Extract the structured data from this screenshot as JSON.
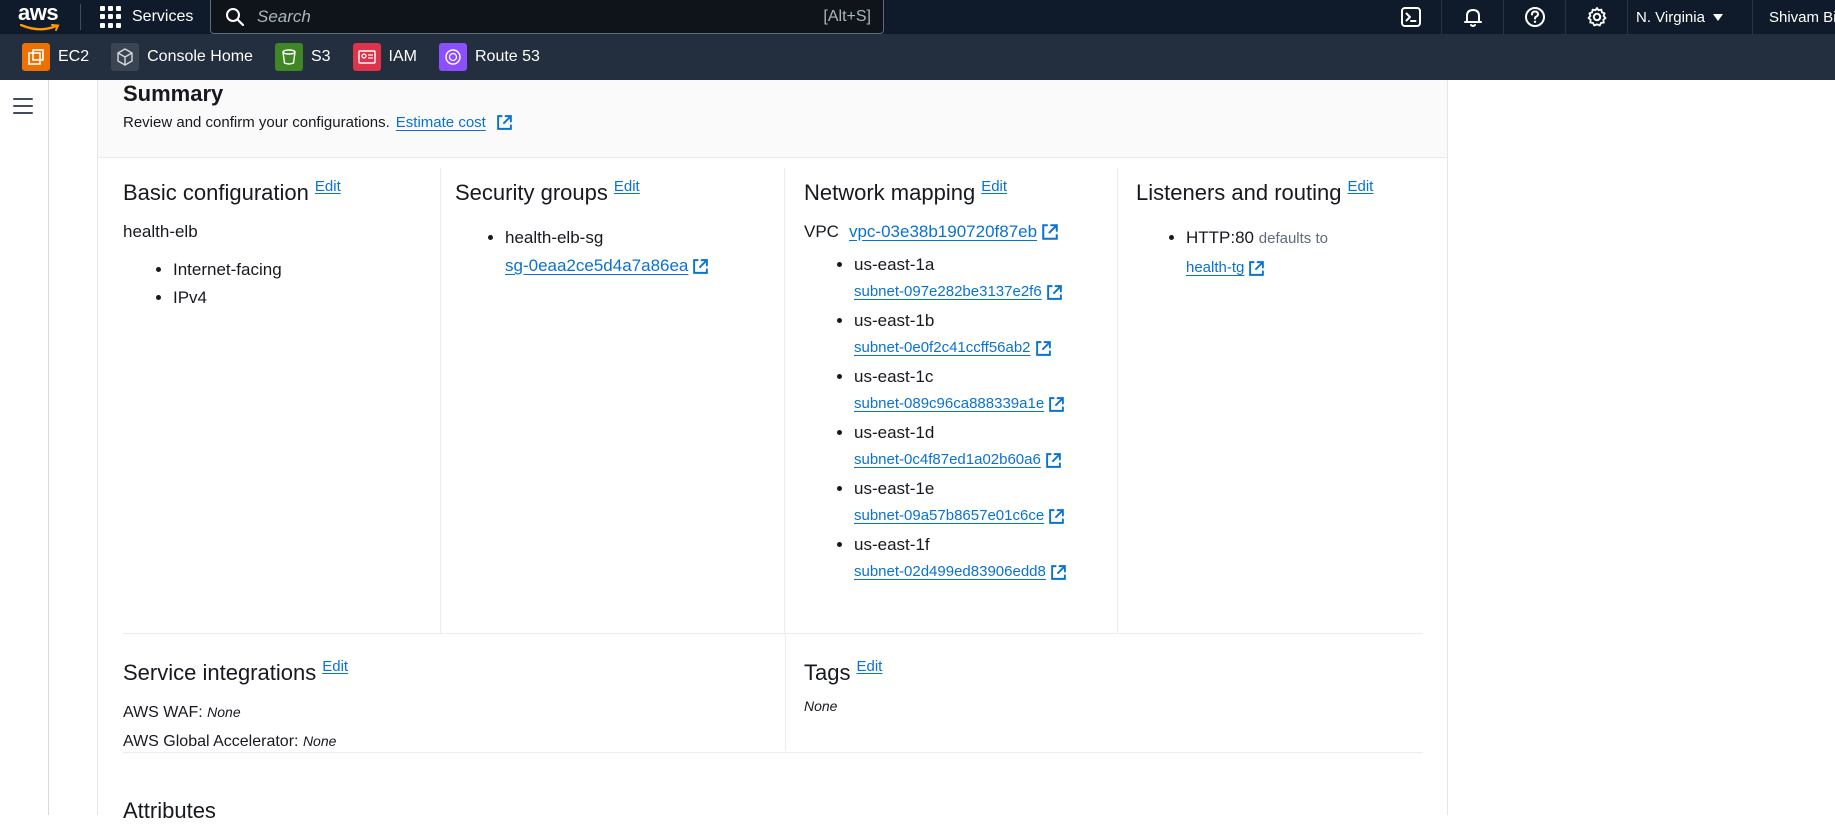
{
  "topbar": {
    "logo_text": "aws",
    "services_label": "Services",
    "search_placeholder": "Search",
    "search_shortcut": "[Alt+S]",
    "icons": [
      "cloudshell-icon",
      "bell-icon",
      "help-icon",
      "gear-icon"
    ],
    "region": "N. Virginia",
    "user": "Shivam Bi"
  },
  "favorites": [
    {
      "label": "EC2",
      "icon": "ec2-icon",
      "color": "#ed7100"
    },
    {
      "label": "Console Home",
      "icon": "cube-icon",
      "color": "#3b4452"
    },
    {
      "label": "S3",
      "icon": "s3-bucket-icon",
      "color": "#3f8624"
    },
    {
      "label": "IAM",
      "icon": "iam-icon",
      "color": "#dd344c"
    },
    {
      "label": "Route 53",
      "icon": "route53-icon",
      "color": "#8c4fff"
    }
  ],
  "summary": {
    "title": "Summary",
    "description": "Review and confirm your configurations.",
    "estimate_link": "Estimate cost"
  },
  "edit_label": "Edit",
  "basic": {
    "title": "Basic configuration",
    "name": "health-elb",
    "items": [
      "Internet-facing",
      "IPv4"
    ]
  },
  "security": {
    "title": "Security groups",
    "group_name": "health-elb-sg",
    "group_id": "sg-0eaa2ce5d4a7a86ea"
  },
  "network": {
    "title": "Network mapping",
    "vpc_label": "VPC",
    "vpc_id": "vpc-03e38b190720f87eb",
    "zones": [
      {
        "az": "us-east-1a",
        "subnet": "subnet-097e282be3137e2f6"
      },
      {
        "az": "us-east-1b",
        "subnet": "subnet-0e0f2c41ccff56ab2"
      },
      {
        "az": "us-east-1c",
        "subnet": "subnet-089c96ca888339a1e"
      },
      {
        "az": "us-east-1d",
        "subnet": "subnet-0c4f87ed1a02b60a6"
      },
      {
        "az": "us-east-1e",
        "subnet": "subnet-09a57b8657e01c6ce"
      },
      {
        "az": "us-east-1f",
        "subnet": "subnet-02d499ed83906edd8"
      }
    ]
  },
  "listeners": {
    "title": "Listeners and routing",
    "listener": "HTTP:80",
    "defaults_text": "defaults to",
    "target_group": "health-tg"
  },
  "integrations": {
    "title": "Service integrations",
    "waf_label": "AWS WAF:",
    "waf_value": "None",
    "ga_label": "AWS Global Accelerator:",
    "ga_value": "None"
  },
  "tags": {
    "title": "Tags",
    "value": "None"
  },
  "attributes": {
    "title": "Attributes"
  }
}
